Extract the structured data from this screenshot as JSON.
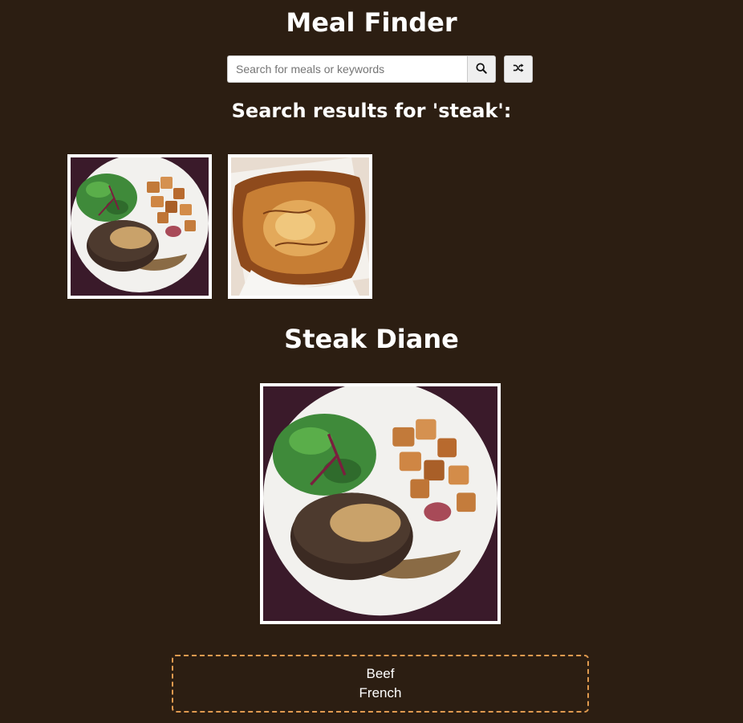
{
  "app": {
    "title": "Meal Finder"
  },
  "search": {
    "value": "",
    "placeholder": "Search for meals or keywords",
    "search_button_icon": "search-icon",
    "random_button_icon": "shuffle-icon"
  },
  "results": {
    "heading": "Search results for 'steak':",
    "items": [
      {
        "icon": "steak-diane-photo"
      },
      {
        "icon": "steak-pie-photo"
      }
    ]
  },
  "meal": {
    "title": "Steak Diane",
    "category": "Beef",
    "area": "French"
  },
  "colors": {
    "background": "#2c1e12",
    "text": "#ffffff",
    "info_border": "#e09a4f"
  }
}
